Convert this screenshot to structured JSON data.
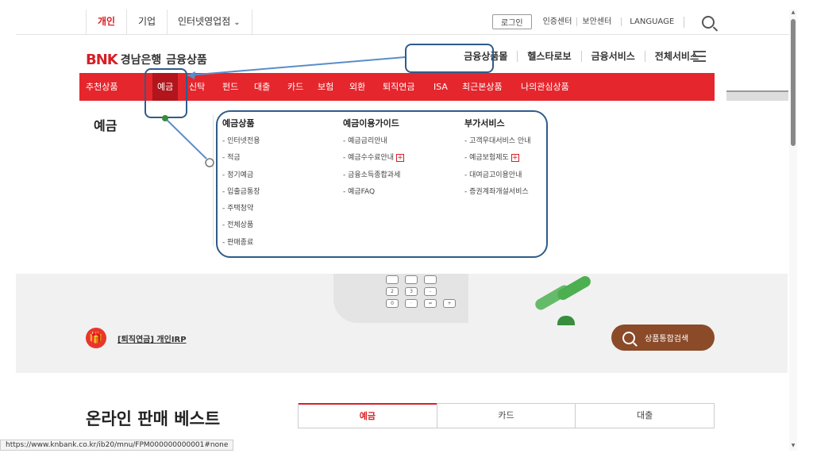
{
  "topbar": {
    "tabs": [
      "개인",
      "기업",
      "인터넷영업점"
    ],
    "login": "로그인",
    "links": [
      "인증센터",
      "보안센터",
      "LANGUAGE"
    ]
  },
  "logo": {
    "mark": "BNK",
    "bank": "경남은행",
    "product": "금융상품"
  },
  "util_menu": [
    "금융상품몰",
    "헬스타로보",
    "금융서비스",
    "전체서비스"
  ],
  "gnb": [
    "추천상품",
    "예금",
    "신탁",
    "펀드",
    "대출",
    "카드",
    "보험",
    "외환",
    "퇴직연금",
    "ISA",
    "최근본상품",
    "나의관심상품"
  ],
  "mega": {
    "title": "예금",
    "columns": [
      {
        "head": "예금상품",
        "items": [
          "- 인터넷전용",
          "- 적금",
          "- 정기예금",
          "- 입출금통장",
          "- 주택청약",
          "- 전체상품",
          "- 판매종료"
        ]
      },
      {
        "head": "예금이용가이드",
        "items": [
          "- 예금금리안내",
          "- 예금수수료안내",
          "- 금융소득종합과세",
          "- 예금FAQ"
        ]
      },
      {
        "head": "부가서비스",
        "items": [
          "- 고객우대서비스 안내",
          "- 예금보험제도",
          "- 대여금고이용안내",
          "- 증권계좌개설서비스"
        ]
      }
    ]
  },
  "banner": {
    "keys": [
      "2",
      "3",
      "-",
      "0",
      "·",
      "=",
      "+"
    ],
    "irp_link": "[퇴직연금] 개인IRP",
    "search_button": "상품통합검색"
  },
  "best": {
    "title": "온라인 판매 베스트",
    "tabs": [
      "예금",
      "카드",
      "대출"
    ]
  },
  "status_url": "https://www.knbank.co.kr/ib20/mnu/FPM000000000001#none",
  "colors": {
    "brand_red": "#e5262d",
    "active_red": "#b2151c",
    "annotation": "#2f5c8a",
    "dot": "#3a8a3a"
  }
}
